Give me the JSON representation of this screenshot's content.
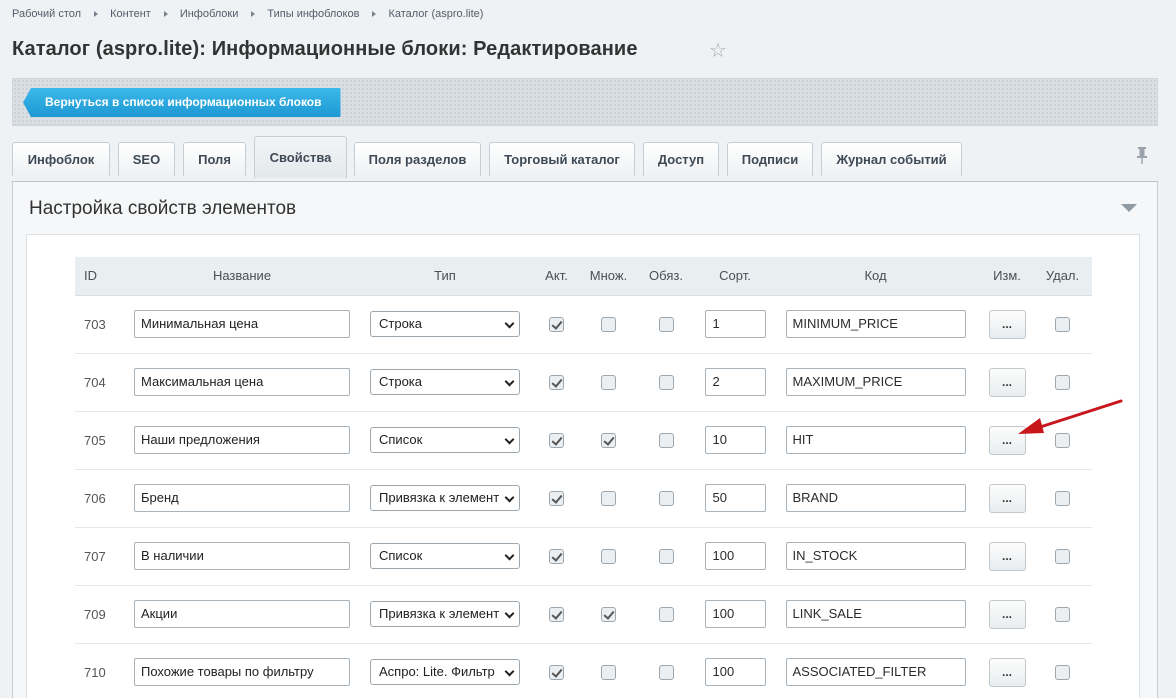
{
  "breadcrumb": [
    "Рабочий стол",
    "Контент",
    "Инфоблоки",
    "Типы инфоблоков",
    "Каталог (aspro.lite)"
  ],
  "title": "Каталог (aspro.lite): Информационные блоки: Редактирование",
  "back_button": "Вернуться в список информационных блоков",
  "tabs": [
    "Инфоблок",
    "SEO",
    "Поля",
    "Свойства",
    "Поля разделов",
    "Торговый каталог",
    "Доступ",
    "Подписи",
    "Журнал событий"
  ],
  "active_tab": "Свойства",
  "section_title": "Настройка свойств элементов",
  "columns": [
    "ID",
    "Название",
    "Тип",
    "Акт.",
    "Множ.",
    "Обяз.",
    "Сорт.",
    "Код",
    "Изм.",
    "Удал."
  ],
  "edit_label": "...",
  "rows": [
    {
      "id": "703",
      "name": "Минимальная цена",
      "type": "Строка",
      "active": true,
      "multiple": false,
      "required": false,
      "sort": "1",
      "code": "MINIMUM_PRICE",
      "delete": false
    },
    {
      "id": "704",
      "name": "Максимальная цена",
      "type": "Строка",
      "active": true,
      "multiple": false,
      "required": false,
      "sort": "2",
      "code": "MAXIMUM_PRICE",
      "delete": false
    },
    {
      "id": "705",
      "name": "Наши предложения",
      "type": "Список",
      "active": true,
      "multiple": true,
      "required": false,
      "sort": "10",
      "code": "HIT",
      "delete": false
    },
    {
      "id": "706",
      "name": "Бренд",
      "type": "Привязка к элемент",
      "active": true,
      "multiple": false,
      "required": false,
      "sort": "50",
      "code": "BRAND",
      "delete": false
    },
    {
      "id": "707",
      "name": "В наличии",
      "type": "Список",
      "active": true,
      "multiple": false,
      "required": false,
      "sort": "100",
      "code": "IN_STOCK",
      "delete": false
    },
    {
      "id": "709",
      "name": "Акции",
      "type": "Привязка к элемент",
      "active": true,
      "multiple": true,
      "required": false,
      "sort": "100",
      "code": "LINK_SALE",
      "delete": false
    },
    {
      "id": "710",
      "name": "Похожие товары по фильтру",
      "type": "Аспро: Lite. Фильтр",
      "active": true,
      "multiple": false,
      "required": false,
      "sort": "100",
      "code": "ASSOCIATED_FILTER",
      "delete": false
    }
  ],
  "colors": {
    "accent": "#1e98d2",
    "annotation_arrow": "#c8161d"
  },
  "icons": [
    "star-icon",
    "pin-icon",
    "chevron-down-icon",
    "arrow-annotation-icon"
  ]
}
